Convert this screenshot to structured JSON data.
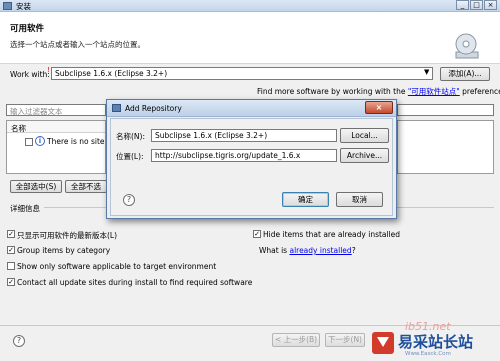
{
  "window": {
    "title": "安装"
  },
  "header": {
    "title": "可用软件",
    "subtitle": "选择一个站点或者输入一个站点的位置。"
  },
  "work_with": {
    "label": "Work with:",
    "value": "Subclipse 1.6.x (Eclipse 3.2+)",
    "add_button": "添加(A)..."
  },
  "more_software": {
    "prefix": "Find more software by working with the ",
    "link": "\"可用软件站点\"",
    "suffix": " preferences."
  },
  "filter": {
    "placeholder": "输入过滤器文本"
  },
  "table": {
    "column": "名称",
    "row_text": "There is no site s"
  },
  "buttons": {
    "select_all": "全部选中(S)",
    "deselect_all": "全部不选"
  },
  "details": {
    "label": "详细信息"
  },
  "options": {
    "show_latest": "只显示可用软件的最新版本(L)",
    "group_by_category": "Group items by category",
    "show_applicable": "Show only software applicable to target environment",
    "contact_sites": "Contact all update sites during install to find required software",
    "hide_installed": "Hide items that are already installed",
    "what_is_prefix": "What is ",
    "already_installed_link": "already installed",
    "what_is_suffix": "?"
  },
  "nav": {
    "back": "< 上一步(B)",
    "next": "下一步(N)"
  },
  "dialog": {
    "title": "Add Repository",
    "name_label": "名称(N):",
    "name_value": "Subclipse 1.6.x (Eclipse 3.2+)",
    "local_button": "Local...",
    "location_label": "位置(L):",
    "location_value": "http://subclipse.tigris.org/update_1.6.x",
    "archive_button": "Archive...",
    "ok_button": "确定",
    "cancel_button": "取消"
  },
  "watermark": {
    "text": "易采站长站",
    "url_text": "ib51.net",
    "sub": "Www.Easck.Com"
  },
  "icons": {
    "help": "help-icon",
    "cd": "cd-icon",
    "info": "info-icon",
    "dropdown": "chevron-down-icon",
    "close": "close-icon"
  }
}
